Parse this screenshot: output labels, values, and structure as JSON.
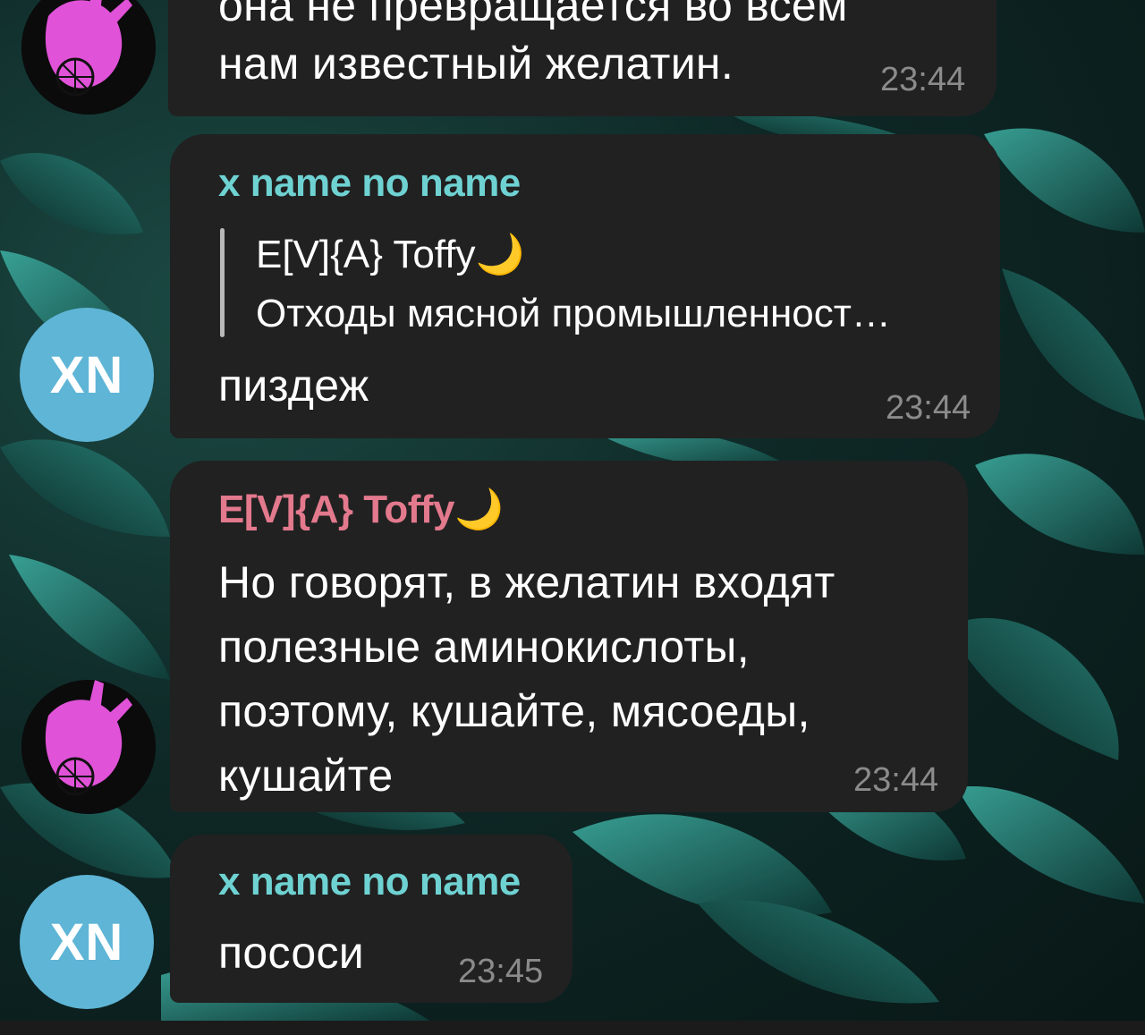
{
  "colors": {
    "bubble_bg": "#212121",
    "timestamp": "#8b8b8b",
    "sender_teal": "#6fd2d2",
    "sender_pink": "#e3798d",
    "avatar_initials_bg": "#5fb5d6",
    "reply_bar": "#b9b9b9"
  },
  "messages": [
    {
      "text_partial_top": "она не превращается во всем",
      "text": "нам известный желатин.",
      "time": "23:44",
      "avatar": "pink-hand-image-icon"
    },
    {
      "sender": "x name no name",
      "reply": {
        "name": "E[V]{A} Toffy",
        "emoji": "🌙",
        "text": "Отходы мясной промышленност…"
      },
      "text": "пиздеж",
      "time": "23:44",
      "avatar_initials": "XN"
    },
    {
      "sender": "E[V]{A} Toffy",
      "sender_emoji": "🌙",
      "text": "Но говорят, в желатин входят\nполезные аминокислоты,\nпоэтому, кушайте, мясоеды,\nкушайте",
      "time": "23:44",
      "avatar": "pink-hand-image-icon"
    },
    {
      "sender": "x name no name",
      "text": "пососи",
      "time": "23:45",
      "avatar_initials": "XN"
    }
  ]
}
